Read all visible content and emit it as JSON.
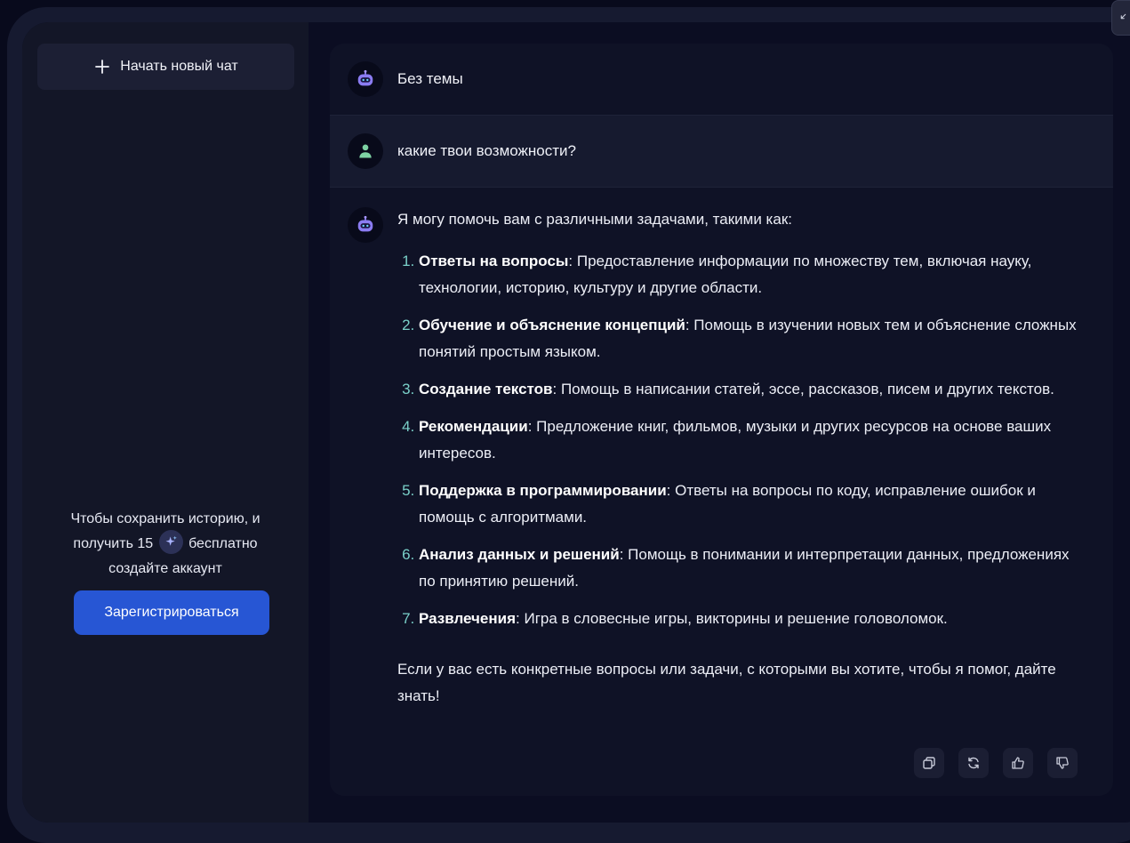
{
  "sidebar": {
    "new_chat_label": "Начать новый чат",
    "promo": {
      "line1": "Чтобы сохранить историю, и",
      "line2_before": "получить",
      "credits": "15",
      "line2_after": "бесплатно",
      "line3": "создайте аккаунт"
    },
    "register_label": "Зарегистрироваться"
  },
  "chat": {
    "title": "Без темы",
    "user_message": "какие твои возможности?",
    "bot_intro": "Я могу помочь вам с различными задачами, такими как:",
    "bot_items": [
      {
        "bold": "Ответы на вопросы",
        "text": ": Предоставление информации по множеству тем, включая науку, технологии, историю, культуру и другие области."
      },
      {
        "bold": "Обучение и объяснение концепций",
        "text": ": Помощь в изучении новых тем и объяснение сложных понятий простым языком."
      },
      {
        "bold": "Создание текстов",
        "text": ": Помощь в написании статей, эссе, рассказов, писем и других текстов."
      },
      {
        "bold": "Рекомендации",
        "text": ": Предложение книг, фильмов, музыки и других ресурсов на основе ваших интересов."
      },
      {
        "bold": "Поддержка в программировании",
        "text": ": Ответы на вопросы по коду, исправление ошибок и помощь с алгоритмами."
      },
      {
        "bold": "Анализ данных и решений",
        "text": ": Помощь в понимании и интерпретации данных, предложениях по принятию решений."
      },
      {
        "bold": "Развлечения",
        "text": ": Игра в словесные игры, викторины и решение головоломок."
      }
    ],
    "bot_outro": "Если у вас есть конкретные вопросы или задачи, с которыми вы хотите, чтобы я помог, дайте знать!"
  },
  "icons": {
    "bot_avatar": "robot-icon",
    "user_avatar": "user-icon",
    "credits": "sparkle-icon",
    "actions": [
      "copy-icon",
      "regenerate-icon",
      "thumbs-up-icon",
      "thumbs-down-icon"
    ],
    "corner": "collapse-icon"
  },
  "colors": {
    "accent": "#2756d4",
    "list_marker": "#7ad0c9",
    "bot_avatar": "#8b7cf2",
    "user_avatar": "#7ed3a4"
  }
}
